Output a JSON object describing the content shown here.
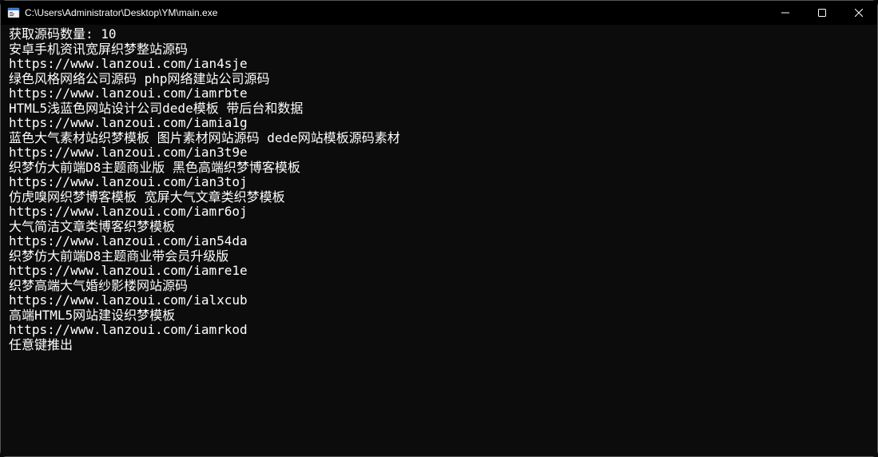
{
  "window": {
    "title": "C:\\Users\\Administrator\\Desktop\\YM\\main.exe"
  },
  "console": {
    "header_line": "获取源码数量: 10",
    "entries": [
      {
        "title": "安卓手机资讯宽屏织梦整站源码",
        "url": "https://www.lanzoui.com/ian4sje"
      },
      {
        "title": "绿色风格网络公司源码 php网络建站公司源码",
        "url": "https://www.lanzoui.com/iamrbte"
      },
      {
        "title": "HTML5浅蓝色网站设计公司dede模板 带后台和数据",
        "url": "https://www.lanzoui.com/iamia1g"
      },
      {
        "title": "蓝色大气素材站织梦模板 图片素材网站源码 dede网站模板源码素材",
        "url": "https://www.lanzoui.com/ian3t9e"
      },
      {
        "title": "织梦仿大前端D8主题商业版 黑色高端织梦博客模板",
        "url": "https://www.lanzoui.com/ian3toj"
      },
      {
        "title": "仿虎嗅网织梦博客模板 宽屏大气文章类织梦模板",
        "url": "https://www.lanzoui.com/iamr6oj"
      },
      {
        "title": "大气简洁文章类博客织梦模板",
        "url": "https://www.lanzoui.com/ian54da"
      },
      {
        "title": "织梦仿大前端D8主题商业带会员升级版",
        "url": "https://www.lanzoui.com/iamre1e"
      },
      {
        "title": "织梦高端大气婚纱影楼网站源码",
        "url": "https://www.lanzoui.com/ialxcub"
      },
      {
        "title": "高端HTML5网站建设织梦模板",
        "url": "https://www.lanzoui.com/iamrkod"
      }
    ],
    "footer_line": "任意键推出"
  }
}
